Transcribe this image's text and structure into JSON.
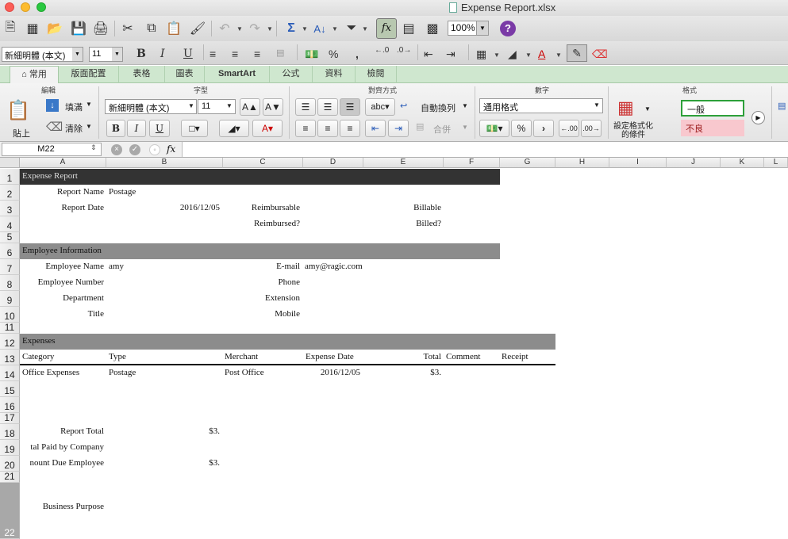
{
  "window": {
    "title": "Expense Report.xlsx"
  },
  "toolbar": {
    "zoom": "100%"
  },
  "format_bar": {
    "font": "新細明體 (本文)",
    "size": "11"
  },
  "ribbon_tabs": [
    "常用",
    "版面配置",
    "表格",
    "圖表",
    "SmartArt",
    "公式",
    "資料",
    "檢閱"
  ],
  "ribbon": {
    "group_edit": "編輯",
    "group_font": "字型",
    "group_align": "對齊方式",
    "group_number": "數字",
    "group_format": "格式",
    "paste": "貼上",
    "fill": "填滿",
    "clear": "清除",
    "font": "新細明體 (本文)",
    "size": "11",
    "wrap": "自動換列",
    "abc": "abc",
    "merge": "合併",
    "number_format": "通用格式",
    "cond_format": "設定格式化的條件",
    "style_normal": "一般",
    "style_bad": "不良"
  },
  "formula_bar": {
    "cell_ref": "M22",
    "formula": ""
  },
  "columns": [
    "A",
    "B",
    "C",
    "D",
    "E",
    "F",
    "G",
    "H",
    "I",
    "J",
    "K",
    "L"
  ],
  "rows": [
    "1",
    "2",
    "3",
    "4",
    "5",
    "6",
    "7",
    "8",
    "9",
    "10",
    "11",
    "12",
    "13",
    "14",
    "15",
    "16",
    "17",
    "18",
    "19",
    "20",
    "21",
    "22"
  ],
  "sheet": {
    "section1": "Expense Report",
    "report_name_label": "Report Name",
    "report_name": "Postage",
    "report_date_label": "Report Date",
    "report_date": "2016/12/05",
    "reimbursable": "Reimbursable",
    "billable": "Billable",
    "reimbursed": "Reimbursed?",
    "billed": "Billed?",
    "section2": "Employee Information",
    "emp_name_label": "Employee Name",
    "emp_name": "amy",
    "email_label": "E-mail",
    "email": "amy@ragic.com",
    "emp_number_label": "Employee Number",
    "phone_label": "Phone",
    "department_label": "Department",
    "extension_label": "Extension",
    "title_label": "Title",
    "mobile_label": "Mobile",
    "section3": "Expenses",
    "headers": [
      "Category",
      "Type",
      "Merchant",
      "Expense Date",
      "Total",
      "Comment",
      "Receipt"
    ],
    "expense_row": [
      "Office Expenses",
      "Postage",
      "Post Office",
      "2016/12/05",
      "$3."
    ],
    "report_total_label": "Report Total",
    "report_total": "$3.",
    "paid_by_company_label": "tal Paid by Company",
    "amount_due_label": "nount Due Employee",
    "amount_due": "$3.",
    "business_purpose": "Business Purpose"
  }
}
